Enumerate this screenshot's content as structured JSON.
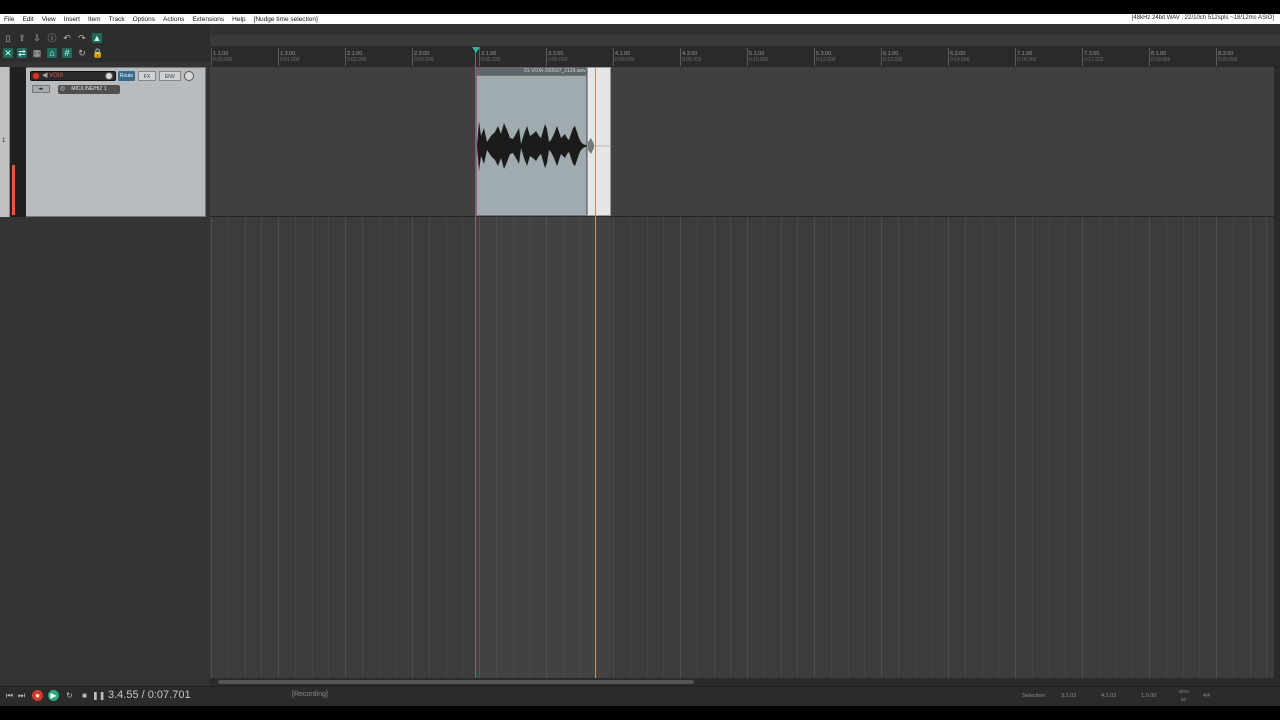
{
  "menu": {
    "items": [
      "File",
      "Edit",
      "View",
      "Insert",
      "Item",
      "Track",
      "Options",
      "Actions",
      "Extensions",
      "Help"
    ],
    "last_action": "[Nudge time selection]",
    "audio_status": "[48kHz 24bit WAV : 22/10ch 512spls ~18/12ms ASIO]"
  },
  "ruler": {
    "bars": [
      {
        "label": "1.1.00",
        "time": "0:00.000"
      },
      {
        "label": "1.3.00",
        "time": "0:01.000"
      },
      {
        "label": "2.1.00",
        "time": "0:02.000"
      },
      {
        "label": "2.3.00",
        "time": "0:03.000"
      },
      {
        "label": "3.1.00",
        "time": "0:05.333"
      },
      {
        "label": "3.3.00",
        "time": "0:06.000"
      },
      {
        "label": "4.1.00",
        "time": "0:08.000"
      },
      {
        "label": "4.3.00",
        "time": "0:09.333"
      },
      {
        "label": "5.1.00",
        "time": "0:10.666"
      },
      {
        "label": "5.3.00",
        "time": "0:12.000"
      },
      {
        "label": "6.1.00",
        "time": "0:13.333"
      },
      {
        "label": "6.3.00",
        "time": "0:14.666"
      },
      {
        "label": "7.1.00",
        "time": "0:16.000"
      },
      {
        "label": "7.3.00",
        "time": "0:17.333"
      },
      {
        "label": "8.1.00",
        "time": "0:18.666"
      },
      {
        "label": "8.3.00",
        "time": "0:20.000"
      }
    ]
  },
  "track": {
    "number": "1",
    "name": "VOIX",
    "route_label": "Route",
    "fx_label": "FX",
    "env_label": "ENV",
    "input": "MIC/LINE/HIZ 1",
    "record_armed": true
  },
  "item": {
    "name": "01-VOIX-200507_2129.wav"
  },
  "transport": {
    "position": "3.4.55 / 0:07.701",
    "status": "[Recording]",
    "selection_label": "Selection:",
    "selection_start": "3.1.02",
    "selection_end": "4.1.02",
    "selection_length": "1.0.00",
    "bpm_label": "BPM",
    "bpm": "90",
    "time_signature": "4/4"
  },
  "colors": {
    "record": "#d23b2a",
    "play": "#2aa97a",
    "edit_cursor": "#37b59c",
    "play_cursor": "#c98c52",
    "item_body": "#9fabaf"
  }
}
